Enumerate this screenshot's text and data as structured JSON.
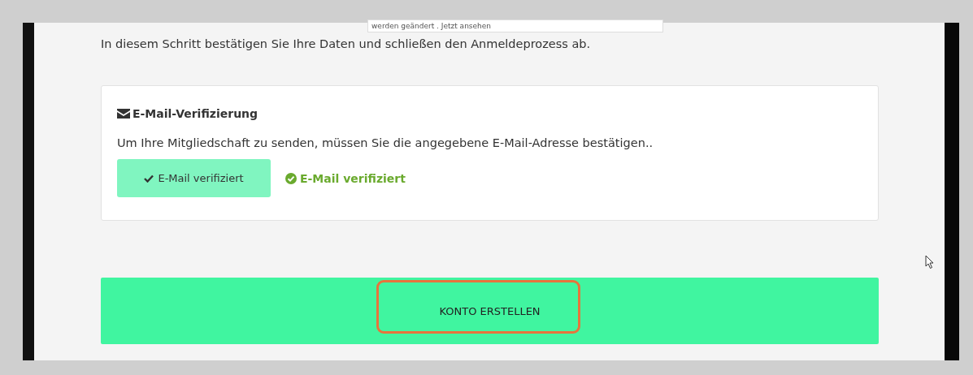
{
  "tooltip": {
    "text": "werden geändert . Jetzt ansehen"
  },
  "intro": "In diesem Schritt bestätigen Sie Ihre Daten und schließen den Anmeldeprozess ab.",
  "card": {
    "title": "E-Mail-Verifizierung",
    "text": "Um Ihre Mitgliedschaft zu senden, müssen Sie die angegebene E-Mail-Adresse bestätigen..",
    "button": "E-Mail verifiziert",
    "status": "E-Mail verifiziert"
  },
  "submit": {
    "label": "KONTO ERSTELLEN",
    "highlighted": true
  }
}
